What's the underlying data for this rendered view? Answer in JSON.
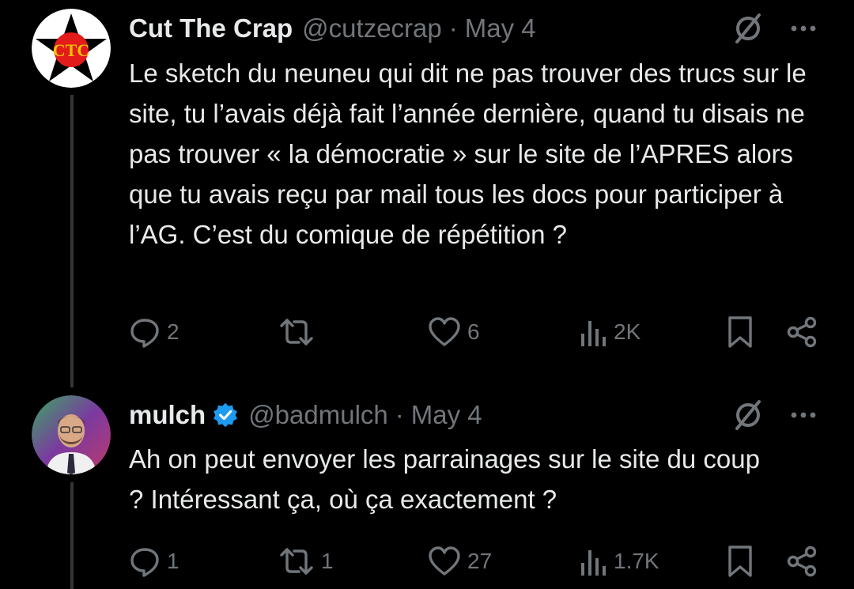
{
  "tweets": [
    {
      "author_name": "Cut The Crap",
      "handle": "@cutzecrap",
      "separator": "·",
      "date": "May 4",
      "verified": false,
      "text": "Le sketch du neuneu qui dit ne pas trouver des trucs sur le site, tu l’avais déjà fait l’année dernière, quand tu disais ne pas trouver « la démocratie » sur le site de l’APRES alors que tu avais reçu par mail tous les docs pour participer à l’AG. C’est du comique de répétition ?",
      "replies": "2",
      "reposts": "",
      "likes": "6",
      "views": "2K"
    },
    {
      "author_name": "mulch",
      "handle": "@badmulch",
      "separator": "·",
      "date": "May 4",
      "verified": true,
      "text": "Ah on peut envoyer les parrainages sur le site du coup ? Intéressant ça, où ça exactement ?",
      "replies": "1",
      "reposts": "1",
      "likes": "27",
      "views": "1.7K"
    }
  ],
  "colors": {
    "background": "#000000",
    "text": "#e7e9ea",
    "secondary": "#71767b",
    "verified": "#1d9bf0",
    "thread_line": "#333639"
  },
  "icons": [
    "grok-icon",
    "more-icon",
    "reply-icon",
    "repost-icon",
    "like-icon",
    "views-icon",
    "bookmark-icon",
    "share-icon",
    "verified-icon"
  ]
}
